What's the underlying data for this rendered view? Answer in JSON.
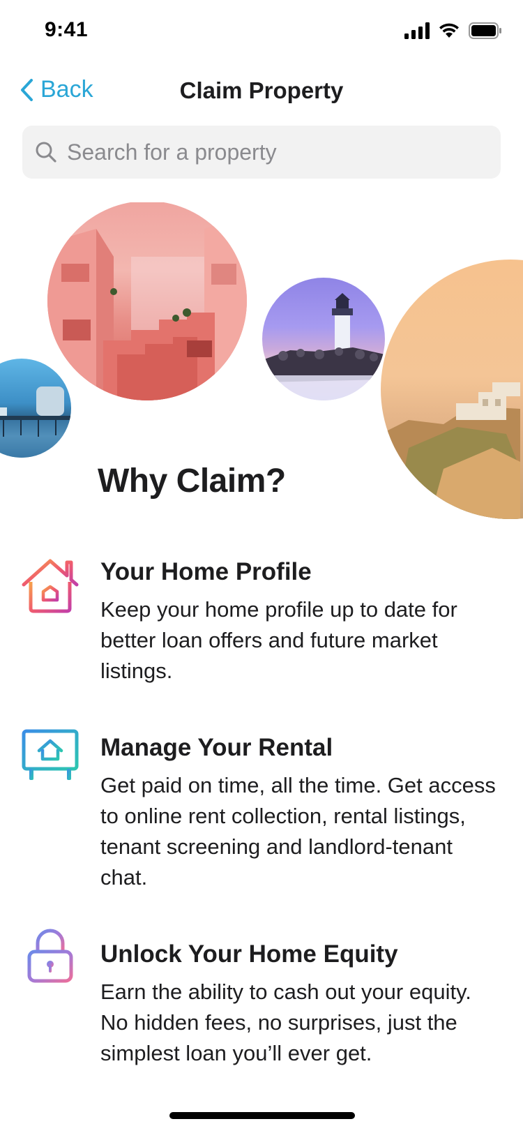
{
  "status": {
    "time": "9:41",
    "icons": [
      "signal-icon",
      "wifi-icon",
      "battery-icon"
    ]
  },
  "nav": {
    "back_label": "Back",
    "title": "Claim Property"
  },
  "search": {
    "placeholder": "Search for a property",
    "value": ""
  },
  "hero": {
    "photos": [
      "pier-at-dusk-photo",
      "pink-building-photo",
      "lighthouse-photo",
      "coastal-cliff-houses-photo"
    ]
  },
  "why": {
    "title": "Why Claim?"
  },
  "features": [
    {
      "icon": "home-icon",
      "title": "Your Home Profile",
      "description": "Keep your home profile up to date for better loan offers and future market listings."
    },
    {
      "icon": "rental-sign-icon",
      "title": "Manage Your Rental",
      "description": "Get paid on time, all the time. Get access to online rent collection, rental listings, tenant screening and landlord-tenant chat."
    },
    {
      "icon": "lock-icon",
      "title": "Unlock Your Home Equity",
      "description": "Earn the ability to cash out your equity. No hidden fees, no surprises, just the simplest loan you’ll ever get."
    }
  ],
  "colors": {
    "accent": "#2aa6d6",
    "search_bg": "#f2f2f2",
    "text": "#1d1d1f"
  }
}
